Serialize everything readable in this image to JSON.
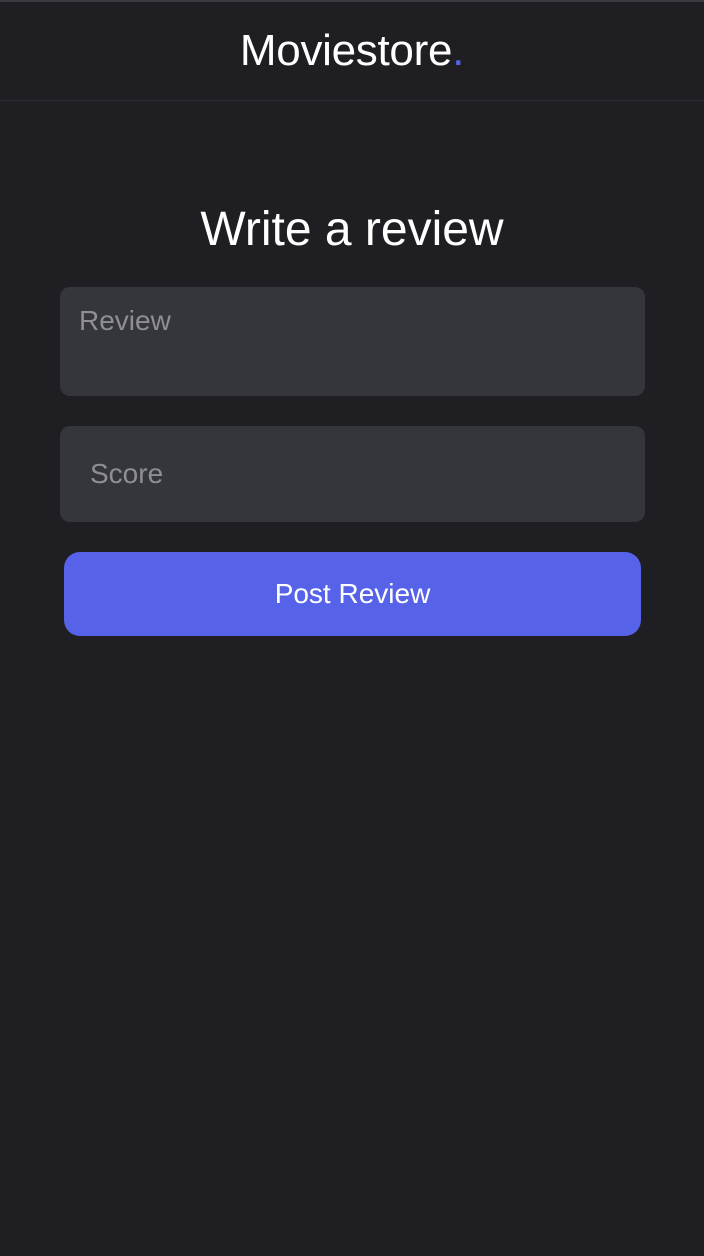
{
  "header": {
    "brand_name": "Moviestore",
    "brand_dot": "."
  },
  "form": {
    "title": "Write a review",
    "review_placeholder": "Review",
    "review_value": "",
    "score_placeholder": "Score",
    "score_value": "",
    "submit_label": "Post Review"
  },
  "colors": {
    "background": "#1f1f23",
    "input_background": "#35363b",
    "accent": "#5662e8",
    "text": "#ffffff",
    "placeholder": "#8e8e94"
  }
}
